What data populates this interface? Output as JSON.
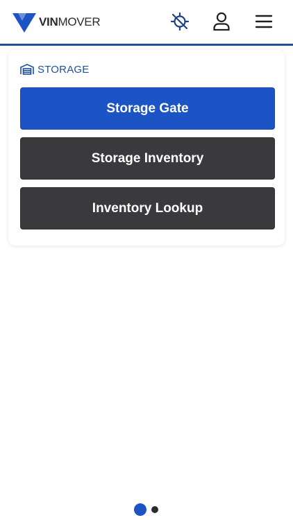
{
  "header": {
    "logo_bold": "VIN",
    "logo_light": "MOVER",
    "icons": [
      "gps-off-icon",
      "user-icon",
      "hamburger-menu-icon"
    ],
    "colors": {
      "brand": "#1f4e9c",
      "logo_mark": "#1c54c5"
    }
  },
  "storage": {
    "section_title": "STORAGE",
    "icon": "warehouse-icon",
    "buttons": [
      {
        "label": "Storage Gate",
        "color": "#1c54c5"
      },
      {
        "label": "Storage Inventory",
        "color": "#3a3a3c"
      },
      {
        "label": "Inventory Lookup",
        "color": "#3a3a3c"
      }
    ]
  },
  "pagination": {
    "pages": 2,
    "current": 1
  }
}
